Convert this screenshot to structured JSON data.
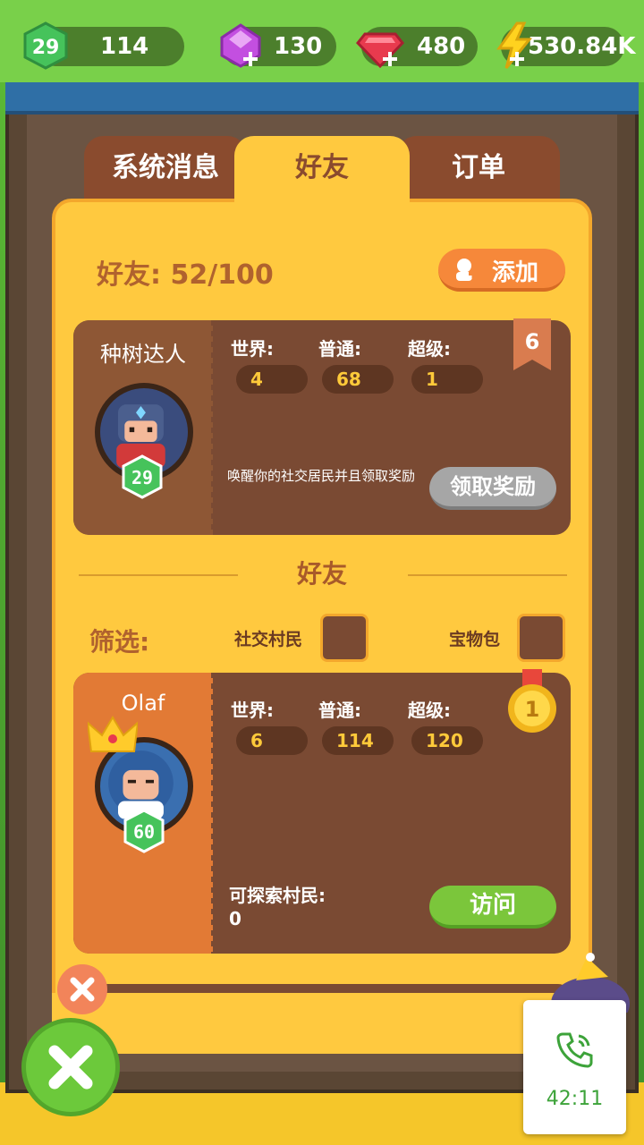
{
  "currencies": {
    "level": "29",
    "level_bar": "114",
    "purple_gems": "130",
    "red_gems": "480",
    "energy": "530.84K"
  },
  "tabs": [
    {
      "label": "系统消息",
      "active": false
    },
    {
      "label": "好友",
      "active": true
    },
    {
      "label": "订单",
      "active": false
    }
  ],
  "friends": {
    "count_label": "好友: 52/100",
    "add_label": "添加"
  },
  "self_card": {
    "name": "种树达人",
    "level": "29",
    "rank": "6",
    "stats": [
      {
        "label": "世界:",
        "value": "4"
      },
      {
        "label": "普通:",
        "value": "68"
      },
      {
        "label": "超级:",
        "value": "1"
      }
    ],
    "description": "唤醒你的社交居民并且领取奖励",
    "claim_label": "领取奖励"
  },
  "friends_section": {
    "title": "好友",
    "filter_label": "筛选:",
    "filter_options": [
      "社交村民",
      "宝物包"
    ]
  },
  "friend_card": {
    "name": "Olaf",
    "level": "60",
    "medal": "1",
    "stats": [
      {
        "label": "世界:",
        "value": "6"
      },
      {
        "label": "普通:",
        "value": "114"
      },
      {
        "label": "超级:",
        "value": "120"
      }
    ],
    "explore_label": "可探索村民:",
    "explore_value": "0",
    "visit_label": "访问"
  },
  "call_widget": {
    "time": "42:11"
  },
  "colors": {
    "panel": "#ffc93f",
    "card": "#7a4a33",
    "accent_orange": "#f6883a",
    "accent_green": "#7bc63b"
  }
}
